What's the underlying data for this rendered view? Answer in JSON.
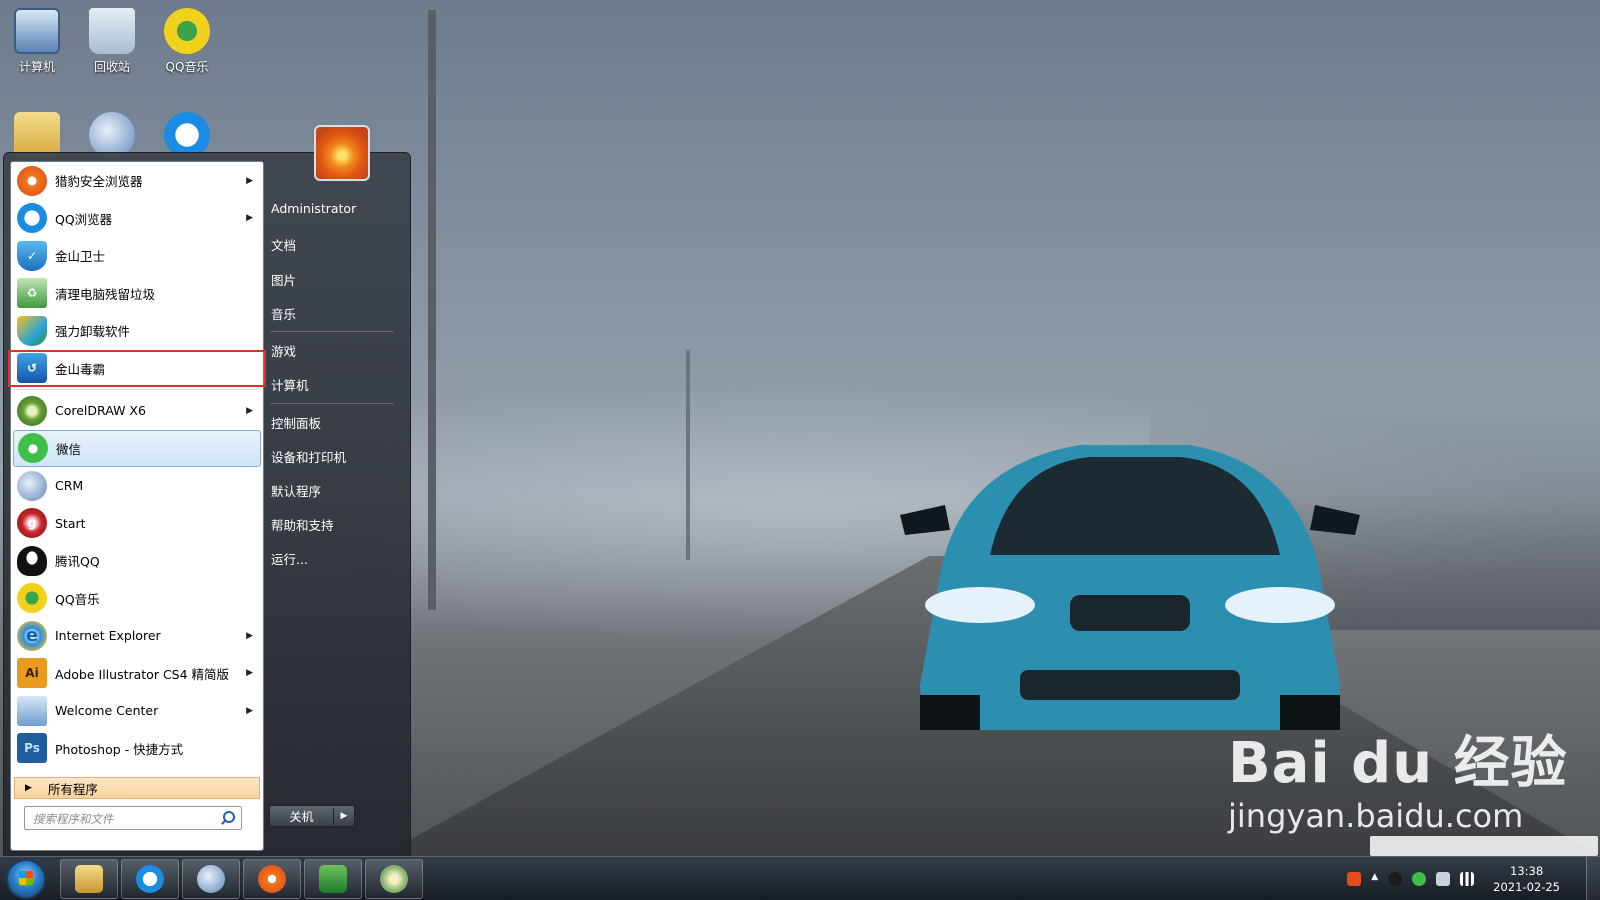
{
  "desktop": {
    "icons": [
      {
        "label": "计算机",
        "icon": "computer-icon"
      },
      {
        "label": "回收站",
        "icon": "recycle-bin-icon"
      },
      {
        "label": "QQ音乐",
        "icon": "qqmusic-icon"
      },
      {
        "label": "",
        "icon": "user-folder-icon"
      },
      {
        "label": "",
        "icon": "network-globe-icon"
      },
      {
        "label": "",
        "icon": "qq-browser-icon"
      }
    ]
  },
  "start_menu": {
    "programs": [
      {
        "label": "猎豹安全浏览器",
        "icon": "liebao-browser-icon",
        "submenu": true
      },
      {
        "label": "QQ浏览器",
        "icon": "qq-browser-icon",
        "submenu": true
      },
      {
        "label": "金山卫士",
        "icon": "kingsoft-guard-icon",
        "submenu": false
      },
      {
        "label": "清理电脑残留垃圾",
        "icon": "cleaner-icon",
        "submenu": false
      },
      {
        "label": "强力卸载软件",
        "icon": "uninstaller-icon",
        "submenu": false
      },
      {
        "label": "金山毒霸",
        "icon": "kingsoft-antivirus-icon",
        "submenu": false,
        "highlighted": true
      },
      {
        "label": "CorelDRAW X6",
        "icon": "coreldraw-icon",
        "submenu": true
      },
      {
        "label": "微信",
        "icon": "wechat-icon",
        "submenu": false,
        "hover": true
      },
      {
        "label": "CRM",
        "icon": "crm-globe-icon",
        "submenu": false
      },
      {
        "label": "Start",
        "icon": "start-app-icon",
        "submenu": false
      },
      {
        "label": "腾讯QQ",
        "icon": "qq-penguin-icon",
        "submenu": false
      },
      {
        "label": "QQ音乐",
        "icon": "qqmusic-icon",
        "submenu": false
      },
      {
        "label": "Internet Explorer",
        "icon": "internet-explorer-icon",
        "submenu": true
      },
      {
        "label": "Adobe Illustrator CS4 精简版",
        "icon": "illustrator-icon",
        "submenu": true
      },
      {
        "label": "Welcome Center",
        "icon": "welcome-center-icon",
        "submenu": true
      },
      {
        "label": "Photoshop - 快捷方式",
        "icon": "photoshop-icon",
        "submenu": false
      }
    ],
    "all_programs": "所有程序",
    "search_placeholder": "搜索程序和文件",
    "right_links": {
      "user": "Administrator",
      "documents": "文档",
      "pictures": "图片",
      "music": "音乐",
      "games": "游戏",
      "computer": "计算机",
      "control_panel": "控制面板",
      "devices": "设备和打印机",
      "default_programs": "默认程序",
      "help": "帮助和支持",
      "run": "运行..."
    },
    "shutdown_label": "关机"
  },
  "taskbar": {
    "pinned": [
      "file-explorer-icon",
      "qq-browser-icon",
      "ie-globe-icon",
      "liebao-browser-icon",
      "excel-icon",
      "network-map-icon"
    ],
    "clock_time": "13:38",
    "clock_date": "2021-02-25"
  },
  "watermark": {
    "brand": "Bai du 经验",
    "url": "jingyan.baidu.com"
  },
  "colors": {
    "highlight_red": "#e0302d",
    "hover_blue": "#cfe4fa",
    "all_programs_orange": "#f8d29d"
  }
}
